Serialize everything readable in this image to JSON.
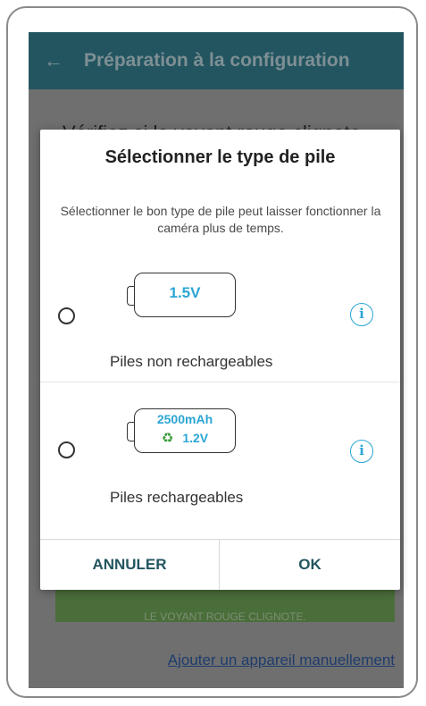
{
  "app_bar": {
    "back_icon": "arrow-left-icon",
    "title": "Préparation à la configuration"
  },
  "background": {
    "instruction": "Vérifiez si le voyant rouge clignote",
    "green_button_label": "LE VOYANT ROUGE CLIGNOTE.",
    "manual_link": "Ajouter un appareil manuellement"
  },
  "dialog": {
    "title": "Sélectionner le type de pile",
    "description": "Sélectionner le bon type de pile peut laisser fonctionner la caméra plus de temps.",
    "options": [
      {
        "battery_voltage": "1.5V",
        "label": "Piles non rechargeables",
        "selected": false
      },
      {
        "battery_capacity": "2500mAh",
        "battery_voltage": "1.2V",
        "recycle_icon": "recycle-icon",
        "label": "Piles rechargeables",
        "selected": false
      }
    ],
    "info_icon": "info-icon",
    "cancel_label": "ANNULER",
    "ok_label": "OK"
  },
  "colors": {
    "app_bar": "#235560",
    "accent": "#2aa6d4",
    "button_text": "#235560",
    "green_button": "#4a6e3a"
  }
}
